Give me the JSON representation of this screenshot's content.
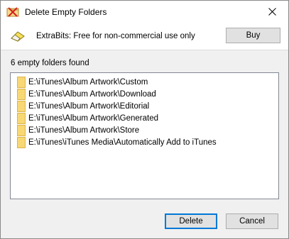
{
  "window": {
    "title": "Delete Empty Folders"
  },
  "banner": {
    "text": "ExtraBits: Free for non-commercial use only",
    "buy_label": "Buy"
  },
  "results": {
    "count_label": "6 empty folders found",
    "folders": [
      "E:\\iTunes\\Album Artwork\\Custom",
      "E:\\iTunes\\Album Artwork\\Download",
      "E:\\iTunes\\Album Artwork\\Editorial",
      "E:\\iTunes\\Album Artwork\\Generated",
      "E:\\iTunes\\Album Artwork\\Store",
      "E:\\iTunes\\iTunes Media\\Automatically Add to iTunes"
    ]
  },
  "buttons": {
    "delete_label": "Delete",
    "cancel_label": "Cancel"
  },
  "colors": {
    "accent": "#0078d7",
    "folder": "#f8d775"
  }
}
